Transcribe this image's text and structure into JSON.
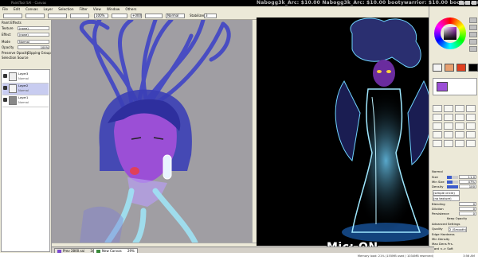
{
  "titlebar": {
    "title": "PaintTool SAI - Canvas"
  },
  "ticker": {
    "text": "Nabogg3k_Arc: $10.00  Nabogg3k_Arc: $10.00  bootywarrior: $10.00  bootywarri"
  },
  "menu": [
    "File",
    "Edit",
    "Canvas",
    "Layer",
    "Selection",
    "Filter",
    "View",
    "Window",
    "Others"
  ],
  "toolbar": {
    "zoom_value": "100%",
    "rotation_value": "+000",
    "blend_label": "Normal",
    "stabilizer_label": "Stabilizer",
    "stabilizer_value": "3"
  },
  "left_panel": {
    "header": "Paint Effects",
    "texture_label": "Texture",
    "texture_value": "(none)",
    "effect_label": "Effect",
    "effect_value": "(none)",
    "mode_label": "Mode",
    "mode_value": "Normal",
    "opacity_label": "Opacity",
    "opacity_value": "100%",
    "preserve_opacity": "Preserve Opacity",
    "clipping_group": "Clipping Group",
    "selection_source": "Selection Source",
    "layers": [
      {
        "name": "Layer3",
        "mode": "Normal",
        "opacity": "100%"
      },
      {
        "name": "Layer2",
        "mode": "Normal",
        "opacity": "100%"
      },
      {
        "name": "Layer1",
        "mode": "Normal",
        "opacity": "100%"
      }
    ]
  },
  "tabs": [
    {
      "label": "Prev 2800.sai",
      "zoom": "34%"
    },
    {
      "label": "New Canvas",
      "zoom": "29%"
    }
  ],
  "status": {
    "memory": "Memory load: 21% (155MB used / 1034MB reserved)",
    "clock": "3:56 AM"
  },
  "overlay": {
    "mic": "Mic: ON"
  },
  "right_panel": {
    "brush_mode": "Normal",
    "size_label": "Size",
    "size_value": "11.0",
    "min_size_label": "Min Size",
    "min_size_value": "47%",
    "density_label": "Density",
    "density_value": "100",
    "shape_label": "(simple circle)",
    "texture_label": "(no texture)",
    "blending_label": "Blending",
    "blending_value": "0",
    "dilution_label": "Dilution",
    "dilution_value": "0",
    "persistence_label": "Persistence",
    "persistence_value": "0",
    "keep_opacity": "Keep Opacity",
    "advanced_settings": "Advanced Settings",
    "quality_label": "Quality",
    "quality_value": "2 (Smooth)",
    "edge_hardness_label": "Edge Hardness",
    "min_density_label": "Min Density",
    "max_dens_label": "Max Dens Prs.",
    "hard_soft_label": "Hard <-> Soft",
    "press_label": "Press:",
    "press_opts": "Dens  Size  Blend"
  },
  "colors": {
    "accent_purple": "#a020c0",
    "canvas_bg": "#a09ea3",
    "hair_blue": "#3a3fc8",
    "skin_purple": "#9b4fd6",
    "glow_blue": "#6fd3ff"
  }
}
